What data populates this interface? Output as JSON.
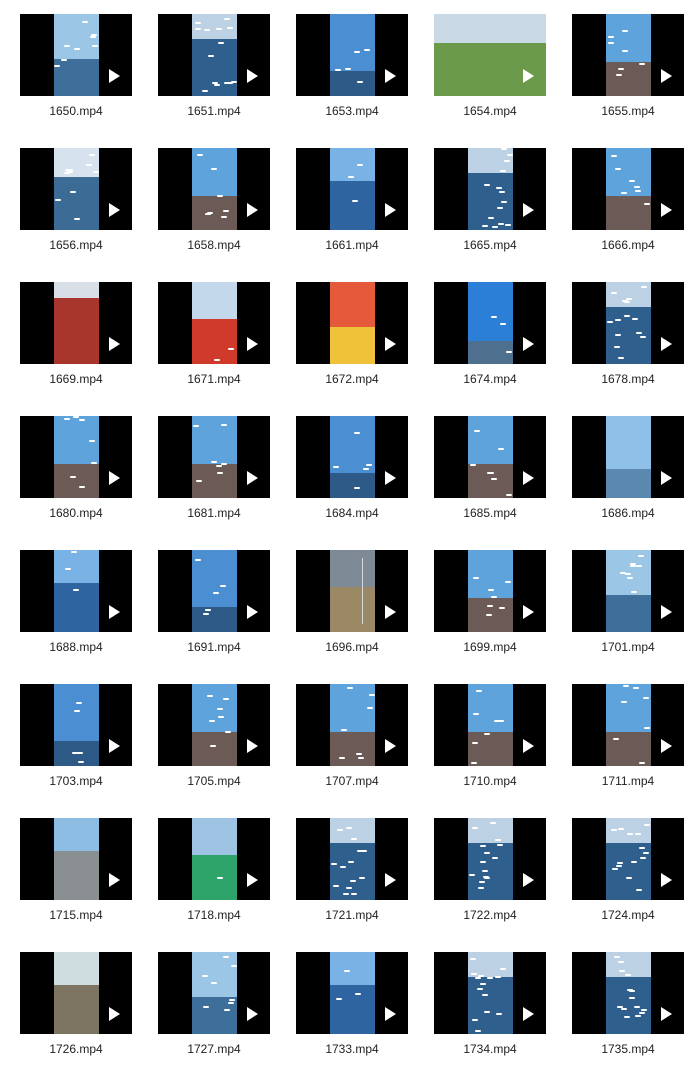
{
  "files": [
    {
      "name": "1650.mp4",
      "scene": "gulls-pier-sky"
    },
    {
      "name": "1651.mp4",
      "scene": "gulls-water"
    },
    {
      "name": "1653.mp4",
      "scene": "gulls-sky-hand"
    },
    {
      "name": "1654.mp4",
      "scene": "field-path-wide"
    },
    {
      "name": "1655.mp4",
      "scene": "gulls-crowd"
    },
    {
      "name": "1656.mp4",
      "scene": "gulls-water-shore"
    },
    {
      "name": "1658.mp4",
      "scene": "gulls-crowd"
    },
    {
      "name": "1661.mp4",
      "scene": "lake-blue"
    },
    {
      "name": "1665.mp4",
      "scene": "gulls-water"
    },
    {
      "name": "1666.mp4",
      "scene": "gulls-crowd"
    },
    {
      "name": "1669.mp4",
      "scene": "red-crowd"
    },
    {
      "name": "1671.mp4",
      "scene": "red-performers"
    },
    {
      "name": "1672.mp4",
      "scene": "red-festival"
    },
    {
      "name": "1674.mp4",
      "scene": "balloon-sky"
    },
    {
      "name": "1678.mp4",
      "scene": "gulls-water"
    },
    {
      "name": "1680.mp4",
      "scene": "gulls-crowd"
    },
    {
      "name": "1681.mp4",
      "scene": "gulls-crowd"
    },
    {
      "name": "1684.mp4",
      "scene": "gulls-sky-hand"
    },
    {
      "name": "1685.mp4",
      "scene": "gulls-crowd"
    },
    {
      "name": "1686.mp4",
      "scene": "glass-corridor"
    },
    {
      "name": "1688.mp4",
      "scene": "lake-blue"
    },
    {
      "name": "1691.mp4",
      "scene": "gulls-sky-hand"
    },
    {
      "name": "1696.mp4",
      "scene": "beach-wide"
    },
    {
      "name": "1699.mp4",
      "scene": "gulls-crowd"
    },
    {
      "name": "1701.mp4",
      "scene": "gulls-pier-sky"
    },
    {
      "name": "1703.mp4",
      "scene": "gulls-sky-hand"
    },
    {
      "name": "1705.mp4",
      "scene": "gulls-crowd"
    },
    {
      "name": "1707.mp4",
      "scene": "gulls-crowd"
    },
    {
      "name": "1710.mp4",
      "scene": "gulls-crowd"
    },
    {
      "name": "1711.mp4",
      "scene": "gulls-crowd"
    },
    {
      "name": "1715.mp4",
      "scene": "street-walk"
    },
    {
      "name": "1718.mp4",
      "scene": "green-performers"
    },
    {
      "name": "1721.mp4",
      "scene": "gulls-water"
    },
    {
      "name": "1722.mp4",
      "scene": "gulls-water"
    },
    {
      "name": "1724.mp4",
      "scene": "gulls-water"
    },
    {
      "name": "1726.mp4",
      "scene": "waterfall-rocks"
    },
    {
      "name": "1727.mp4",
      "scene": "gulls-pier-sky"
    },
    {
      "name": "1733.mp4",
      "scene": "lake-blue"
    },
    {
      "name": "1734.mp4",
      "scene": "gulls-water"
    },
    {
      "name": "1735.mp4",
      "scene": "gulls-water"
    }
  ],
  "play_icon": "play-triangle-icon",
  "thumb_background": "#000000",
  "label_color": "#1f1f1f"
}
